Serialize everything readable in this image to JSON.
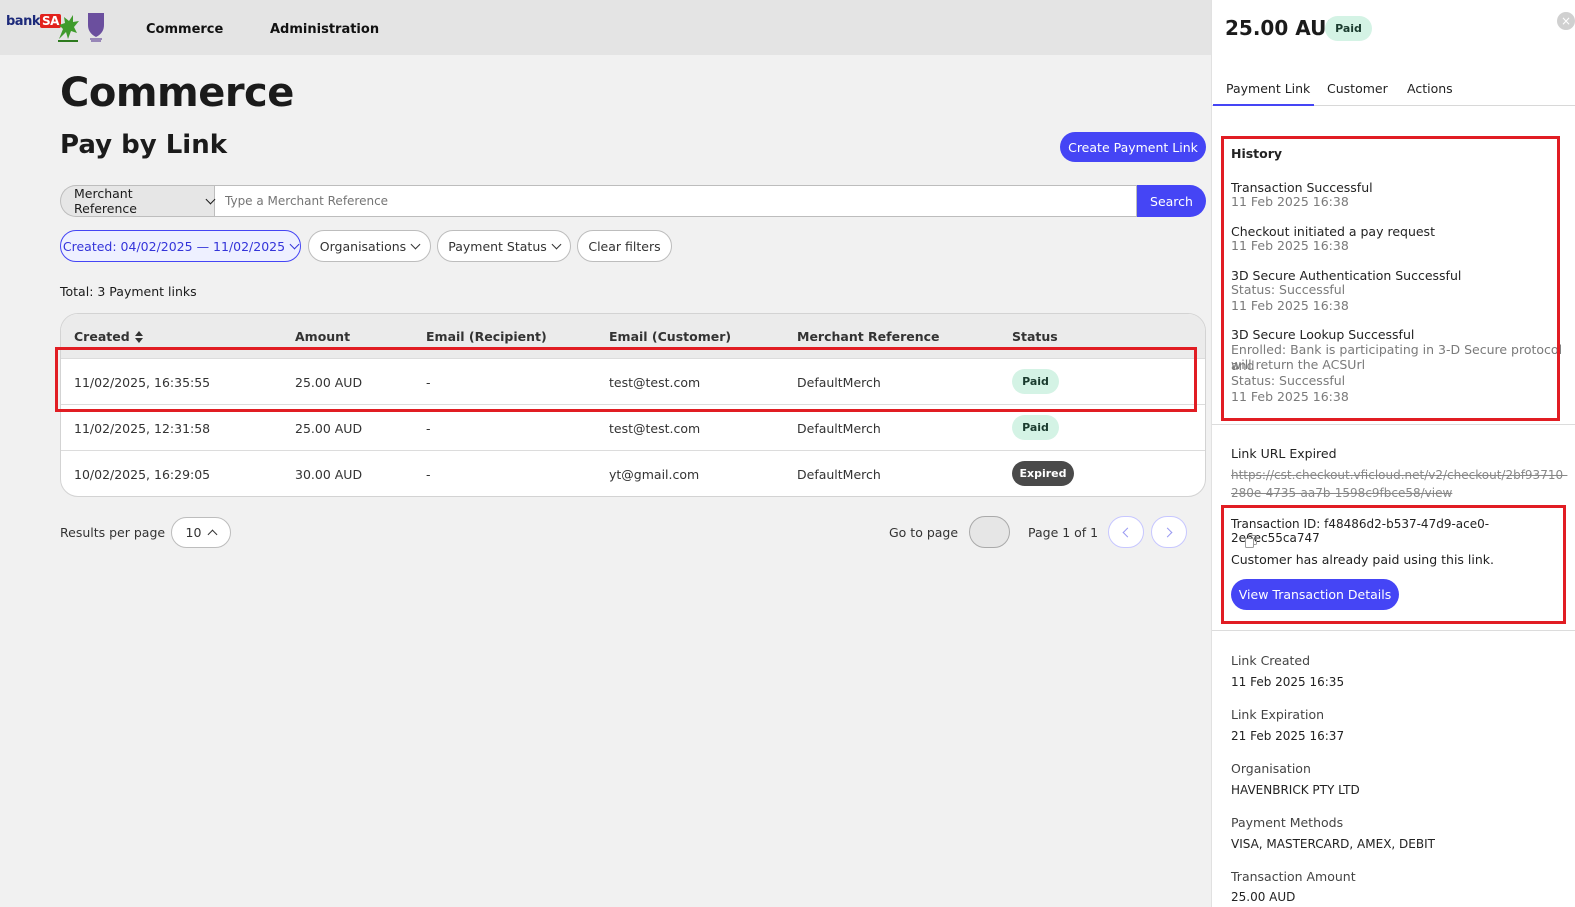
{
  "nav": {
    "logo_bank": "bank",
    "logo_sa": "SA",
    "items": [
      {
        "label": "Commerce"
      },
      {
        "label": "Administration"
      }
    ]
  },
  "main": {
    "title": "Commerce",
    "subtitle": "Pay by Link",
    "create_button": "Create Payment Link",
    "search": {
      "field_type": "Merchant Reference",
      "placeholder": "Type a Merchant Reference",
      "button": "Search"
    },
    "filters": {
      "created": "Created: 04/02/2025 — 11/02/2025",
      "organisations": "Organisations",
      "payment_status": "Payment Status",
      "clear": "Clear filters"
    },
    "total": "Total: 3 Payment links",
    "table": {
      "columns": [
        "Created",
        "Amount",
        "Email (Recipient)",
        "Email (Customer)",
        "Merchant Reference",
        "Status"
      ],
      "rows": [
        {
          "created": "11/02/2025, 16:35:55",
          "amount": "25.00 AUD",
          "recipient": "-",
          "customer": "test@test.com",
          "merchant": "DefaultMerch",
          "status": "Paid"
        },
        {
          "created": "11/02/2025, 12:31:58",
          "amount": "25.00 AUD",
          "recipient": "-",
          "customer": "test@test.com",
          "merchant": "DefaultMerch",
          "status": "Paid"
        },
        {
          "created": "10/02/2025, 16:29:05",
          "amount": "30.00 AUD",
          "recipient": "-",
          "customer": "yt@gmail.com",
          "merchant": "DefaultMerch",
          "status": "Expired"
        }
      ]
    },
    "pagination": {
      "results_label": "Results per page",
      "per_page": "10",
      "goto_label": "Go to page",
      "page_info": "Page 1 of 1"
    }
  },
  "panel": {
    "amount": "25.00 AUD",
    "status": "Paid",
    "close": "×",
    "tabs": [
      "Payment Link",
      "Customer",
      "Actions"
    ],
    "history_title": "History",
    "history": {
      "e1_title": "Transaction Successful",
      "e1_time": "11 Feb 2025 16:38",
      "e2_title": "Checkout initiated a pay request",
      "e2_time": "11 Feb 2025 16:38",
      "e3_title": "3D Secure Authentication Successful",
      "e3_status": "Status: Successful",
      "e3_time": "11 Feb 2025 16:38",
      "e4_title": "3D Secure Lookup Successful",
      "e4_detail1": "Enrolled: Bank is participating in 3-D Secure protocol and",
      "e4_detail2": "will return the ACSUrl",
      "e4_status": "Status: Successful",
      "e4_time": "11 Feb 2025 16:38"
    },
    "link_expired_title": "Link URL Expired",
    "link_url_1": "https://cst.checkout.vficloud.net/v2/checkout/2bf93710-",
    "link_url_2": "280e-4735-aa7b-1598c9fbce58/view",
    "transaction_id": "Transaction ID: f48486d2-b537-47d9-ace0-2e6ec55ca747",
    "already_paid": "Customer has already paid using this link.",
    "view_button": "View Transaction Details",
    "details": {
      "created_label": "Link Created",
      "created_value": "11 Feb 2025 16:35",
      "expiration_label": "Link Expiration",
      "expiration_value": "21 Feb 2025 16:37",
      "org_label": "Organisation",
      "org_value": "HAVENBRICK PTY LTD",
      "methods_label": "Payment Methods",
      "methods_value": "VISA, MASTERCARD, AMEX, DEBIT",
      "amount_label": "Transaction Amount",
      "amount_value": "25.00 AUD"
    }
  },
  "colors": {
    "primary": "#4545f5",
    "paid_badge": "#d4f3e5",
    "expired_badge": "#4a4a4a",
    "highlight": "#e11d23"
  }
}
